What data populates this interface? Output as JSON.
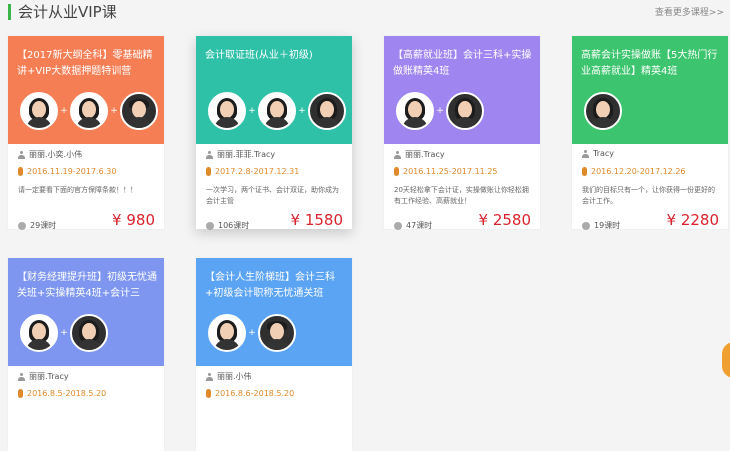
{
  "section": {
    "title": "会计从业VIP课",
    "more_link": "查看更多课程>>"
  },
  "price_prefix": "¥",
  "hours_suffix": "课时",
  "plus_sign": "+",
  "colors": {
    "accent": "#39b54a",
    "price": "#d9232e",
    "date": "#e08a2c"
  },
  "cards": [
    {
      "title": "【2017新大纲全科】零基础精讲+VIP大数据押题特训营",
      "teachers": "丽丽.小奕.小伟",
      "dates": "2016.11.19-2017.6.30",
      "desc": "请一定要看下面的官方保障条款！！！",
      "hours": "29",
      "price": "980",
      "color": "#f57e55",
      "avatars": [
        "female",
        "female",
        "male"
      ]
    },
    {
      "title": "会计取证班(从业＋初级)",
      "teachers": "丽丽.菲菲.Tracy",
      "dates": "2017.2.8-2017.12.31",
      "desc": "一次学习，两个证书、会计双证，助你成为会计主管",
      "hours": "106",
      "price": "1580",
      "color": "#2fc0a8",
      "avatars": [
        "female",
        "female",
        "female-dark"
      ]
    },
    {
      "title": "【高薪就业班】会计三科+实操做账精英4班",
      "teachers": "丽丽.Tracy",
      "dates": "2016.11.25-2017.11.25",
      "desc": "20天轻松拿下会计证，实操做账让你轻松拥有工作经验、高薪就业！",
      "hours": "47",
      "price": "2580",
      "color": "#9f85ef",
      "avatars": [
        "female",
        "female-dark"
      ]
    },
    {
      "title": "高薪会计实操做账【5大热门行业高薪就业】精英4班",
      "teachers": "Tracy",
      "dates": "2016.12.20-2017.12.26",
      "desc": "我们的目标只有一个，让你获得一份更好的会计工作。",
      "hours": "19",
      "price": "2280",
      "color": "#3cc56e",
      "avatars": [
        "female-dark"
      ]
    },
    {
      "title": "【财务经理提升班】初级无忧通关班+实操精英4班+会计三",
      "teachers": "丽丽.Tracy",
      "dates": "2016.8.5-2018.5.20",
      "color": "#7f96f0",
      "avatars": [
        "female",
        "female-dark"
      ]
    },
    {
      "title": "【会计人生阶梯班】会计三科+初级会计职称无忧通关班",
      "teachers": "丽丽.小伟",
      "dates": "2016.8.6-2018.5.20",
      "color": "#5ba3f3",
      "avatars": [
        "female",
        "male"
      ]
    }
  ]
}
